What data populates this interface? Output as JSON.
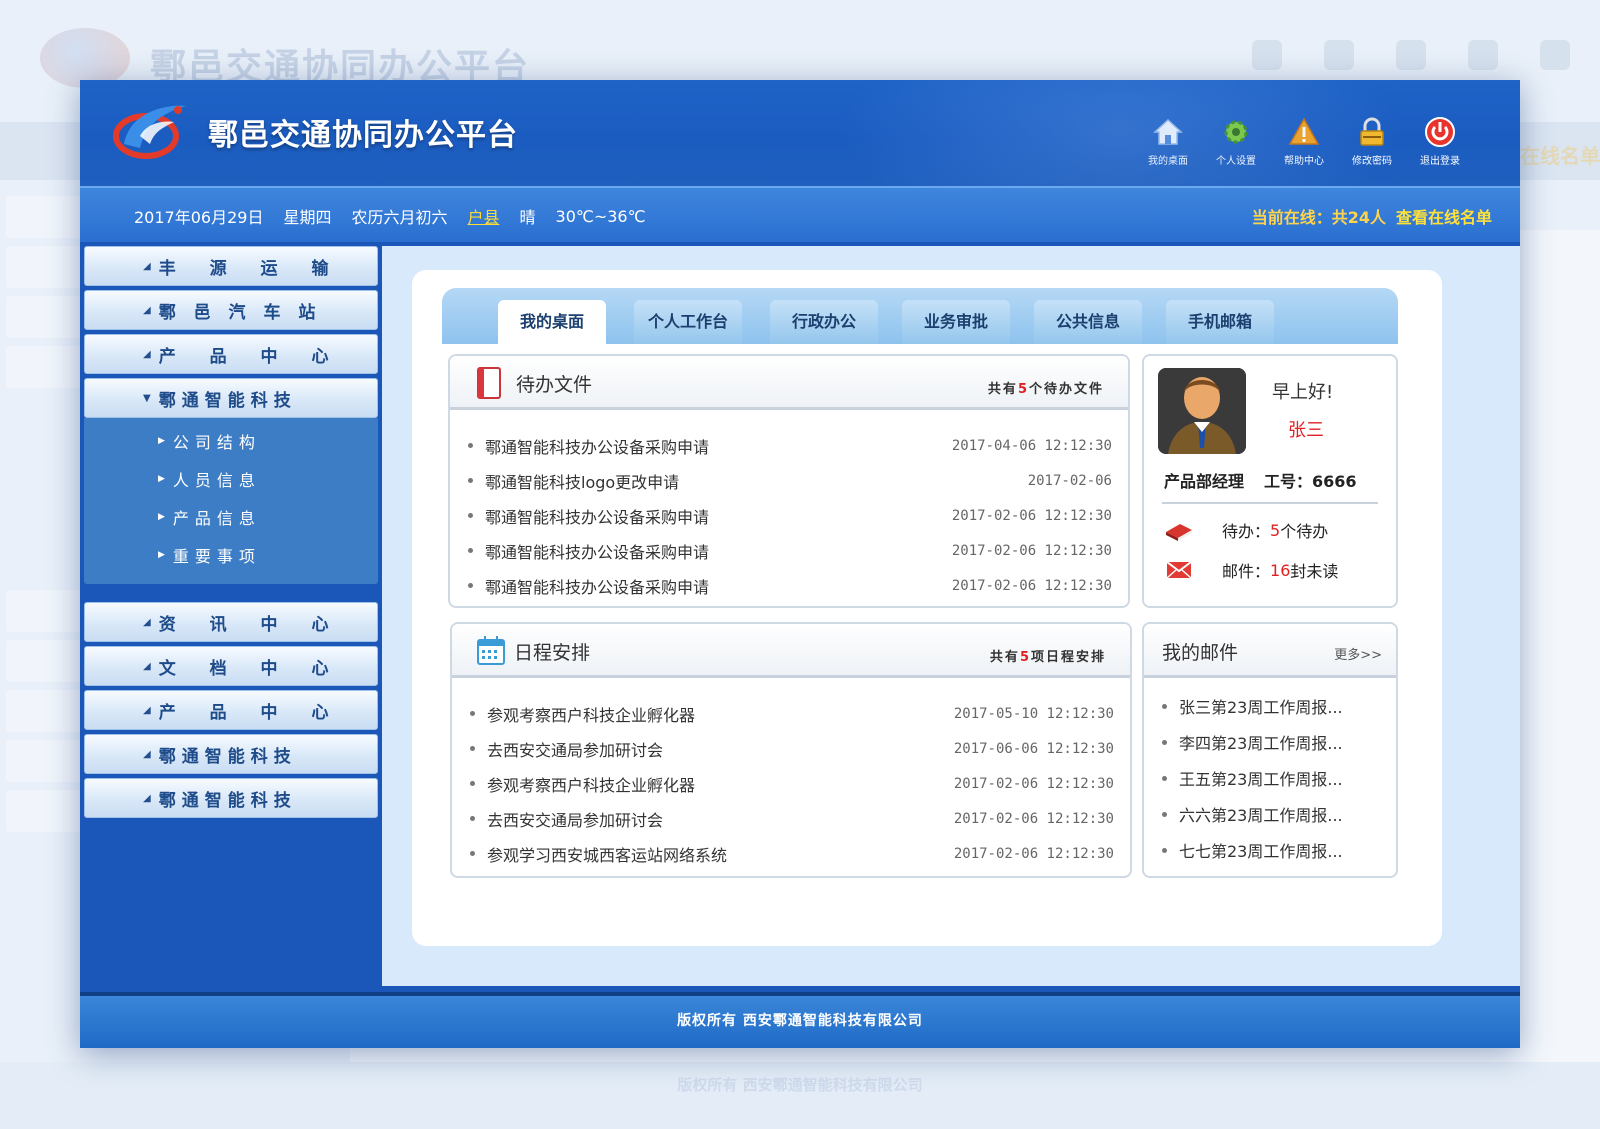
{
  "app": {
    "title": "鄠邑交通协同办公平台"
  },
  "top_icons": [
    {
      "label": "我的桌面",
      "icon": "home-icon"
    },
    {
      "label": "个人设置",
      "icon": "gear-icon"
    },
    {
      "label": "帮助中心",
      "icon": "warning-icon"
    },
    {
      "label": "修改密码",
      "icon": "lock-icon"
    },
    {
      "label": "退出登录",
      "icon": "power-icon"
    }
  ],
  "infobar": {
    "date": "2017年06月29日",
    "weekday": "星期四",
    "lunar": "农历六月初六",
    "city": "户县",
    "weather": "晴",
    "temperature": "30℃~36℃",
    "online_label": "当前在线：共24人",
    "online_link": "查看在线名单"
  },
  "sidebar": {
    "group1": [
      "丰 源 运 输",
      "鄠 邑 汽 车 站",
      "产 品 中 心",
      "鄠通智能科技"
    ],
    "submenu": [
      "公司结构",
      "人员信息",
      "产品信息",
      "重要事项"
    ],
    "group2": [
      "资 讯 中 心",
      "文 档 中 心",
      "产 品 中 心",
      "鄠通智能科技",
      "鄠通智能科技"
    ]
  },
  "tabs": [
    "我的桌面",
    "个人工作台",
    "行政办公",
    "业务审批",
    "公共信息",
    "手机邮箱"
  ],
  "todo": {
    "title": "待办文件",
    "count_prefix": "共有",
    "count": "5",
    "count_suffix": "个待办文件",
    "items": [
      {
        "text": "鄠通智能科技办公设备采购申请",
        "time": "2017-04-06 12:12:30"
      },
      {
        "text": "鄠通智能科技logo更改申请",
        "time": "2017-02-06"
      },
      {
        "text": "鄠通智能科技办公设备采购申请",
        "time": "2017-02-06 12:12:30"
      },
      {
        "text": "鄠通智能科技办公设备采购申请",
        "time": "2017-02-06 12:12:30"
      },
      {
        "text": "鄠通智能科技办公设备采购申请",
        "time": "2017-02-06 12:12:30"
      }
    ]
  },
  "profile": {
    "greeting": "早上好!",
    "name": "张三",
    "position": "产品部经理",
    "job_no": "工号：6666",
    "todo_label": "待办：",
    "todo_count": "5",
    "todo_unit": "个待办",
    "mail_label": "邮件：",
    "mail_count": "16",
    "mail_unit": "封未读"
  },
  "schedule": {
    "title": "日程安排",
    "count_prefix": "共有",
    "count": "5",
    "count_suffix": "项日程安排",
    "items": [
      {
        "text": "参观考察西户科技企业孵化器",
        "time": "2017-05-10 12:12:30"
      },
      {
        "text": "去西安交通局参加研讨会",
        "time": "2017-06-06 12:12:30"
      },
      {
        "text": "参观考察西户科技企业孵化器",
        "time": "2017-02-06 12:12:30"
      },
      {
        "text": "去西安交通局参加研讨会",
        "time": "2017-02-06 12:12:30"
      },
      {
        "text": "参观学习西安城西客运站网络系统",
        "time": "2017-02-06 12:12:30"
      }
    ]
  },
  "mail": {
    "title": "我的邮件",
    "more": "更多>>",
    "items": [
      "张三第23周工作周报...",
      "李四第23周工作周报...",
      "王五第23周工作周报...",
      "六六第23周工作周报...",
      "七七第23周工作周报..."
    ]
  },
  "footer": {
    "copyright": "版权所有 西安鄠通智能科技有限公司"
  },
  "colors": {
    "brand_blue": "#1a57b8",
    "accent_red": "#e02020",
    "accent_yellow": "#ffd44a"
  }
}
